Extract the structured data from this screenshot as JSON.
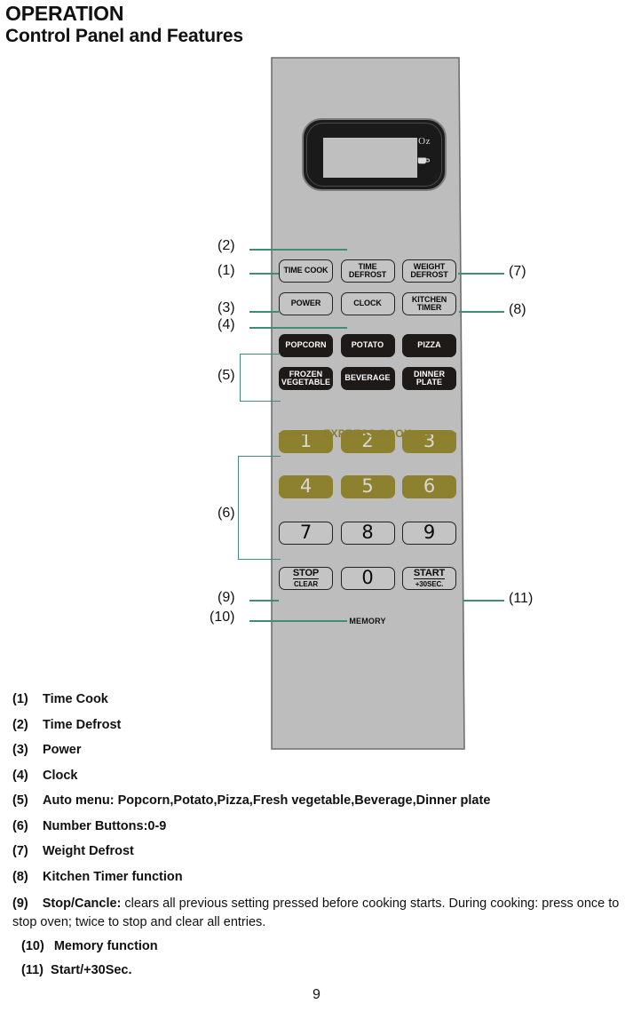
{
  "header": {
    "title": "OPERATION",
    "subtitle": "Control Panel and Features"
  },
  "display": {
    "oz_label": "Oz",
    "cup_icon": "cup-icon"
  },
  "panel": {
    "express_cook_label": "EXPRESS COOK",
    "memory_label": "MEMORY",
    "buttons": {
      "time_cook": "TIME COOK",
      "time_defrost_l1": "TIME",
      "time_defrost_l2": "DEFROST",
      "weight_defrost_l1": "WEIGHT",
      "weight_defrost_l2": "DEFROST",
      "power": "POWER",
      "clock": "CLOCK",
      "kitchen_timer_l1": "KITCHEN",
      "kitchen_timer_l2": "TIMER",
      "popcorn": "POPCORN",
      "potato": "POTATO",
      "pizza": "PIZZA",
      "frozen_vegetable_l1": "FROZEN",
      "frozen_vegetable_l2": "VEGETABLE",
      "beverage": "BEVERAGE",
      "dinner_plate_l1": "DINNER",
      "dinner_plate_l2": "PLATE",
      "num_1": "1",
      "num_2": "2",
      "num_3": "3",
      "num_4": "4",
      "num_5": "5",
      "num_6": "6",
      "num_7": "7",
      "num_8": "8",
      "num_9": "9",
      "num_0": "0",
      "stop_top": "STOP",
      "stop_bottom": "CLEAR",
      "start_top": "START",
      "start_bottom": "+30SEC."
    }
  },
  "callouts": {
    "c1": "(1)",
    "c2": "(2)",
    "c3": "(3)",
    "c4": "(4)",
    "c5": "(5)",
    "c6": "(6)",
    "c7": "(7)",
    "c8": "(8)",
    "c9": "(9)",
    "c10": "(10)",
    "c11": "(11)"
  },
  "legend": {
    "items": [
      {
        "index": "(1)",
        "text": "Time Cook"
      },
      {
        "index": "(2)",
        "text": "Time Defrost"
      },
      {
        "index": "(3)",
        "text": "Power"
      },
      {
        "index": "(4)",
        "text": "Clock"
      },
      {
        "index": "(5)",
        "text": "Auto menu: Popcorn,Potato,Pizza,Fresh vegetable,Beverage,Dinner plate"
      },
      {
        "index": "(6)",
        "text": "Number Buttons:0-9"
      },
      {
        "index": "(7)",
        "text": "Weight Defrost"
      },
      {
        "index": "(8)",
        "text": "Kitchen Timer function"
      }
    ],
    "item9_index": "(9)",
    "item9_bold": "Stop/Cancle:",
    "item9_rest": " clears all previous setting pressed before cooking starts. During cooking: press once to stop oven;  twice  to stop and clear all entries.",
    "item10_index": "(10)",
    "item10_text": "Memory function",
    "item11_index": "(11)",
    "item11_text": "Start/+30Sec."
  },
  "page_number": "9",
  "colors": {
    "panel_gray": "#bdbdbd",
    "button_dark": "#1d1a17",
    "button_olive": "#8d8130",
    "express_olive": "#8a7f2e",
    "leader_teal": "#3f8c7a"
  }
}
